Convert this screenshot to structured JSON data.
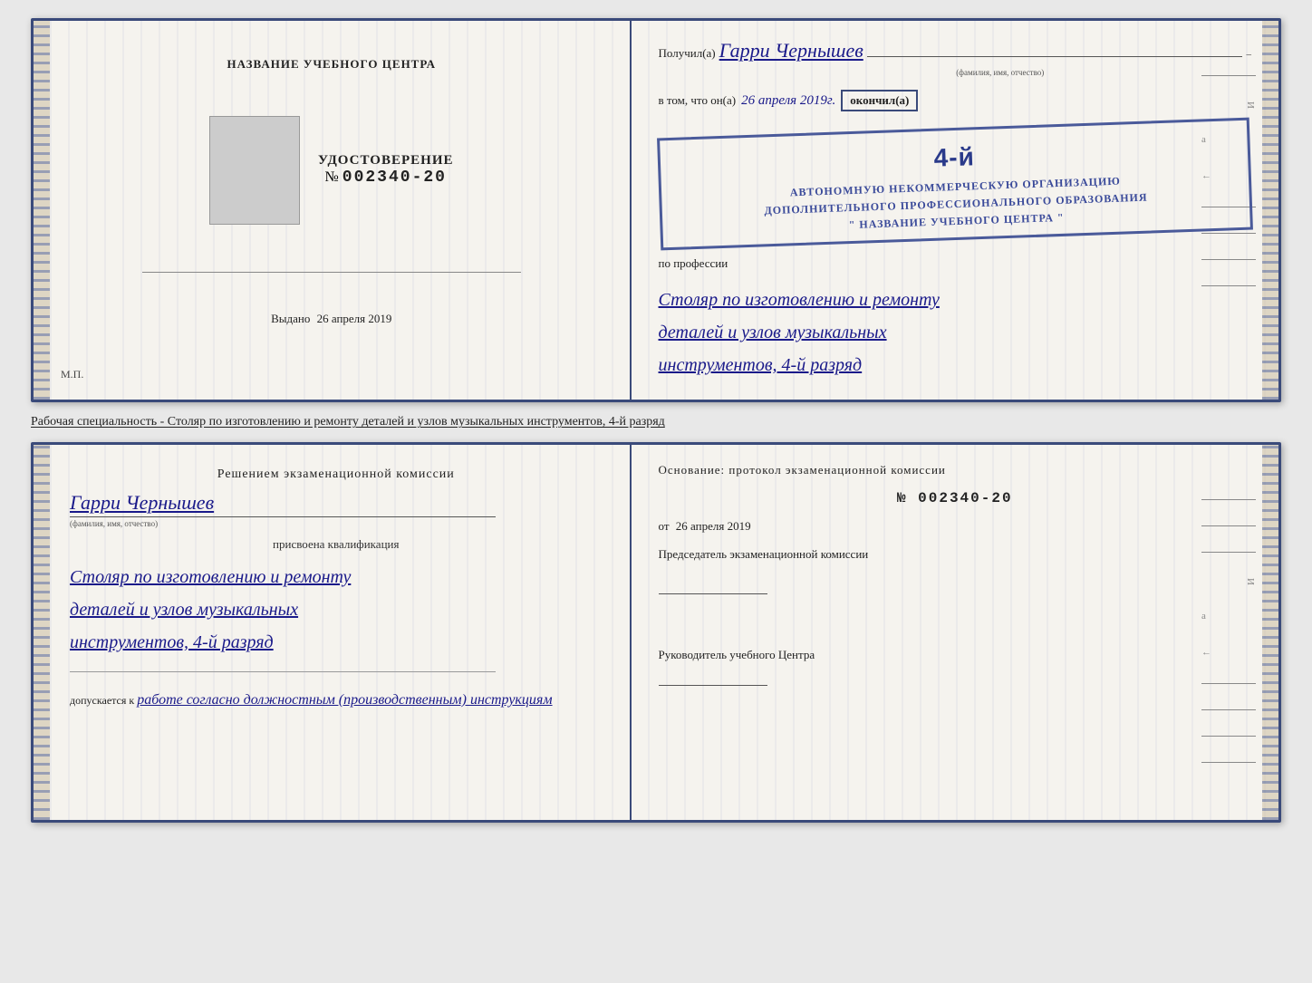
{
  "top_left": {
    "center_title": "НАЗВАНИЕ УЧЕБНОГО ЦЕНТРА",
    "udostoverenie_label": "УДОСТОВЕРЕНИЕ",
    "number_prefix": "№",
    "number": "002340-20",
    "vydano_label": "Выдано",
    "vydano_date": "26 апреля 2019",
    "mp": "М.П."
  },
  "top_right": {
    "poluchil_prefix": "Получил(а)",
    "recipient_name": "Гарри Чернышев",
    "fio_label": "(фамилия, имя, отчество)",
    "vtom_prefix": "в том, что он(а)",
    "date_inline": "26 апреля 2019г.",
    "okonchil": "окончил(а)",
    "stamp_line1": "АВТОНОМНУЮ НЕКОММЕРЧЕСКУЮ ОРГАНИЗАЦИЮ",
    "stamp_line2": "ДОПОЛНИТЕЛЬНОГО ПРОФЕССИОНАЛЬНОГО ОБРАЗОВАНИЯ",
    "stamp_line3": "\" НАЗВАНИЕ УЧЕБНОГО ЦЕНТРА \"",
    "stamp_number": "4-й",
    "po_professii": "по профессии",
    "profession_line1": "Столяр по изготовлению и ремонту",
    "profession_line2": "деталей и узлов музыкальных",
    "profession_line3": "инструментов, 4-й разряд"
  },
  "description": "Рабочая специальность - Столяр по изготовлению и ремонту деталей и узлов музыкальных инструментов, 4-й разряд",
  "bottom_left": {
    "resheniem": "Решением экзаменационной комиссии",
    "name": "Гарри Чернышев",
    "fio_label": "(фамилия, имя, отчество)",
    "prisvoena": "присвоена квалификация",
    "qualification_line1": "Столяр по изготовлению и ремонту",
    "qualification_line2": "деталей и узлов музыкальных",
    "qualification_line3": "инструментов, 4-й разряд",
    "dopuskaetsya": "допускается к",
    "work_text": "работе согласно должностным (производственным) инструкциям"
  },
  "bottom_right": {
    "osnovanie": "Основание: протокол экзаменационной комиссии",
    "number_prefix": "№",
    "number": "002340-20",
    "ot_prefix": "от",
    "date": "26 апреля 2019",
    "predsedatel": "Председатель экзаменационной комиссии",
    "rukovoditel": "Руководитель учебного Центра"
  }
}
